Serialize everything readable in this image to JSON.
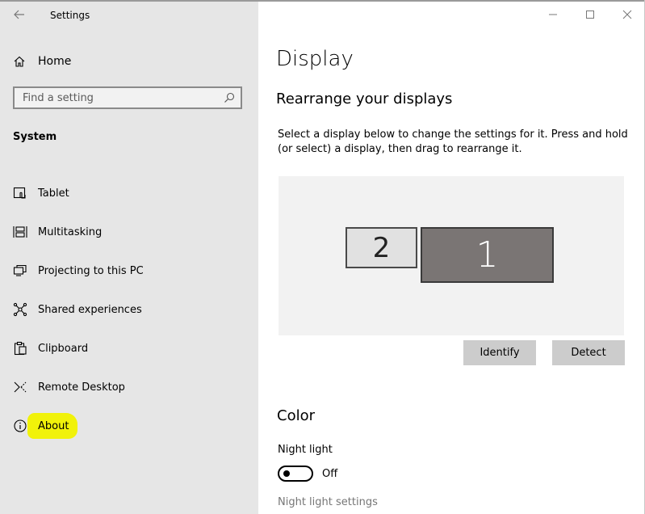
{
  "window": {
    "title": "Settings",
    "controls": [
      "minimize-icon",
      "maximize-icon",
      "close-icon"
    ]
  },
  "sidebar": {
    "home_label": "Home",
    "search": {
      "placeholder": "Find a setting",
      "value": ""
    },
    "section_title": "System",
    "items": [
      {
        "label": "Tablet",
        "icon": "tablet-icon"
      },
      {
        "label": "Multitasking",
        "icon": "multitasking-icon"
      },
      {
        "label": "Projecting to this PC",
        "icon": "projecting-icon"
      },
      {
        "label": "Shared experiences",
        "icon": "shared-experiences-icon"
      },
      {
        "label": "Clipboard",
        "icon": "clipboard-icon"
      },
      {
        "label": "Remote Desktop",
        "icon": "remote-desktop-icon"
      },
      {
        "label": "About",
        "icon": "info-icon",
        "highlighted": true
      }
    ],
    "highlight_color": "#f1f20a"
  },
  "main": {
    "title": "Display",
    "rearrange": {
      "heading": "Rearrange your displays",
      "description": "Select a display below to change the settings for it. Press and hold (or select) a display, then drag to rearrange it.",
      "monitors": [
        {
          "number": "2",
          "selected": false
        },
        {
          "number": "1",
          "selected": true
        }
      ],
      "identify_label": "Identify",
      "detect_label": "Detect"
    },
    "color": {
      "heading": "Color",
      "night_light_label": "Night light",
      "night_light_state": "Off",
      "night_light_settings_link": "Night light settings"
    }
  },
  "colors": {
    "sidebar_bg": "#e6e6e6",
    "selected_monitor": "#7a7574",
    "button_bg": "#cccccc"
  }
}
